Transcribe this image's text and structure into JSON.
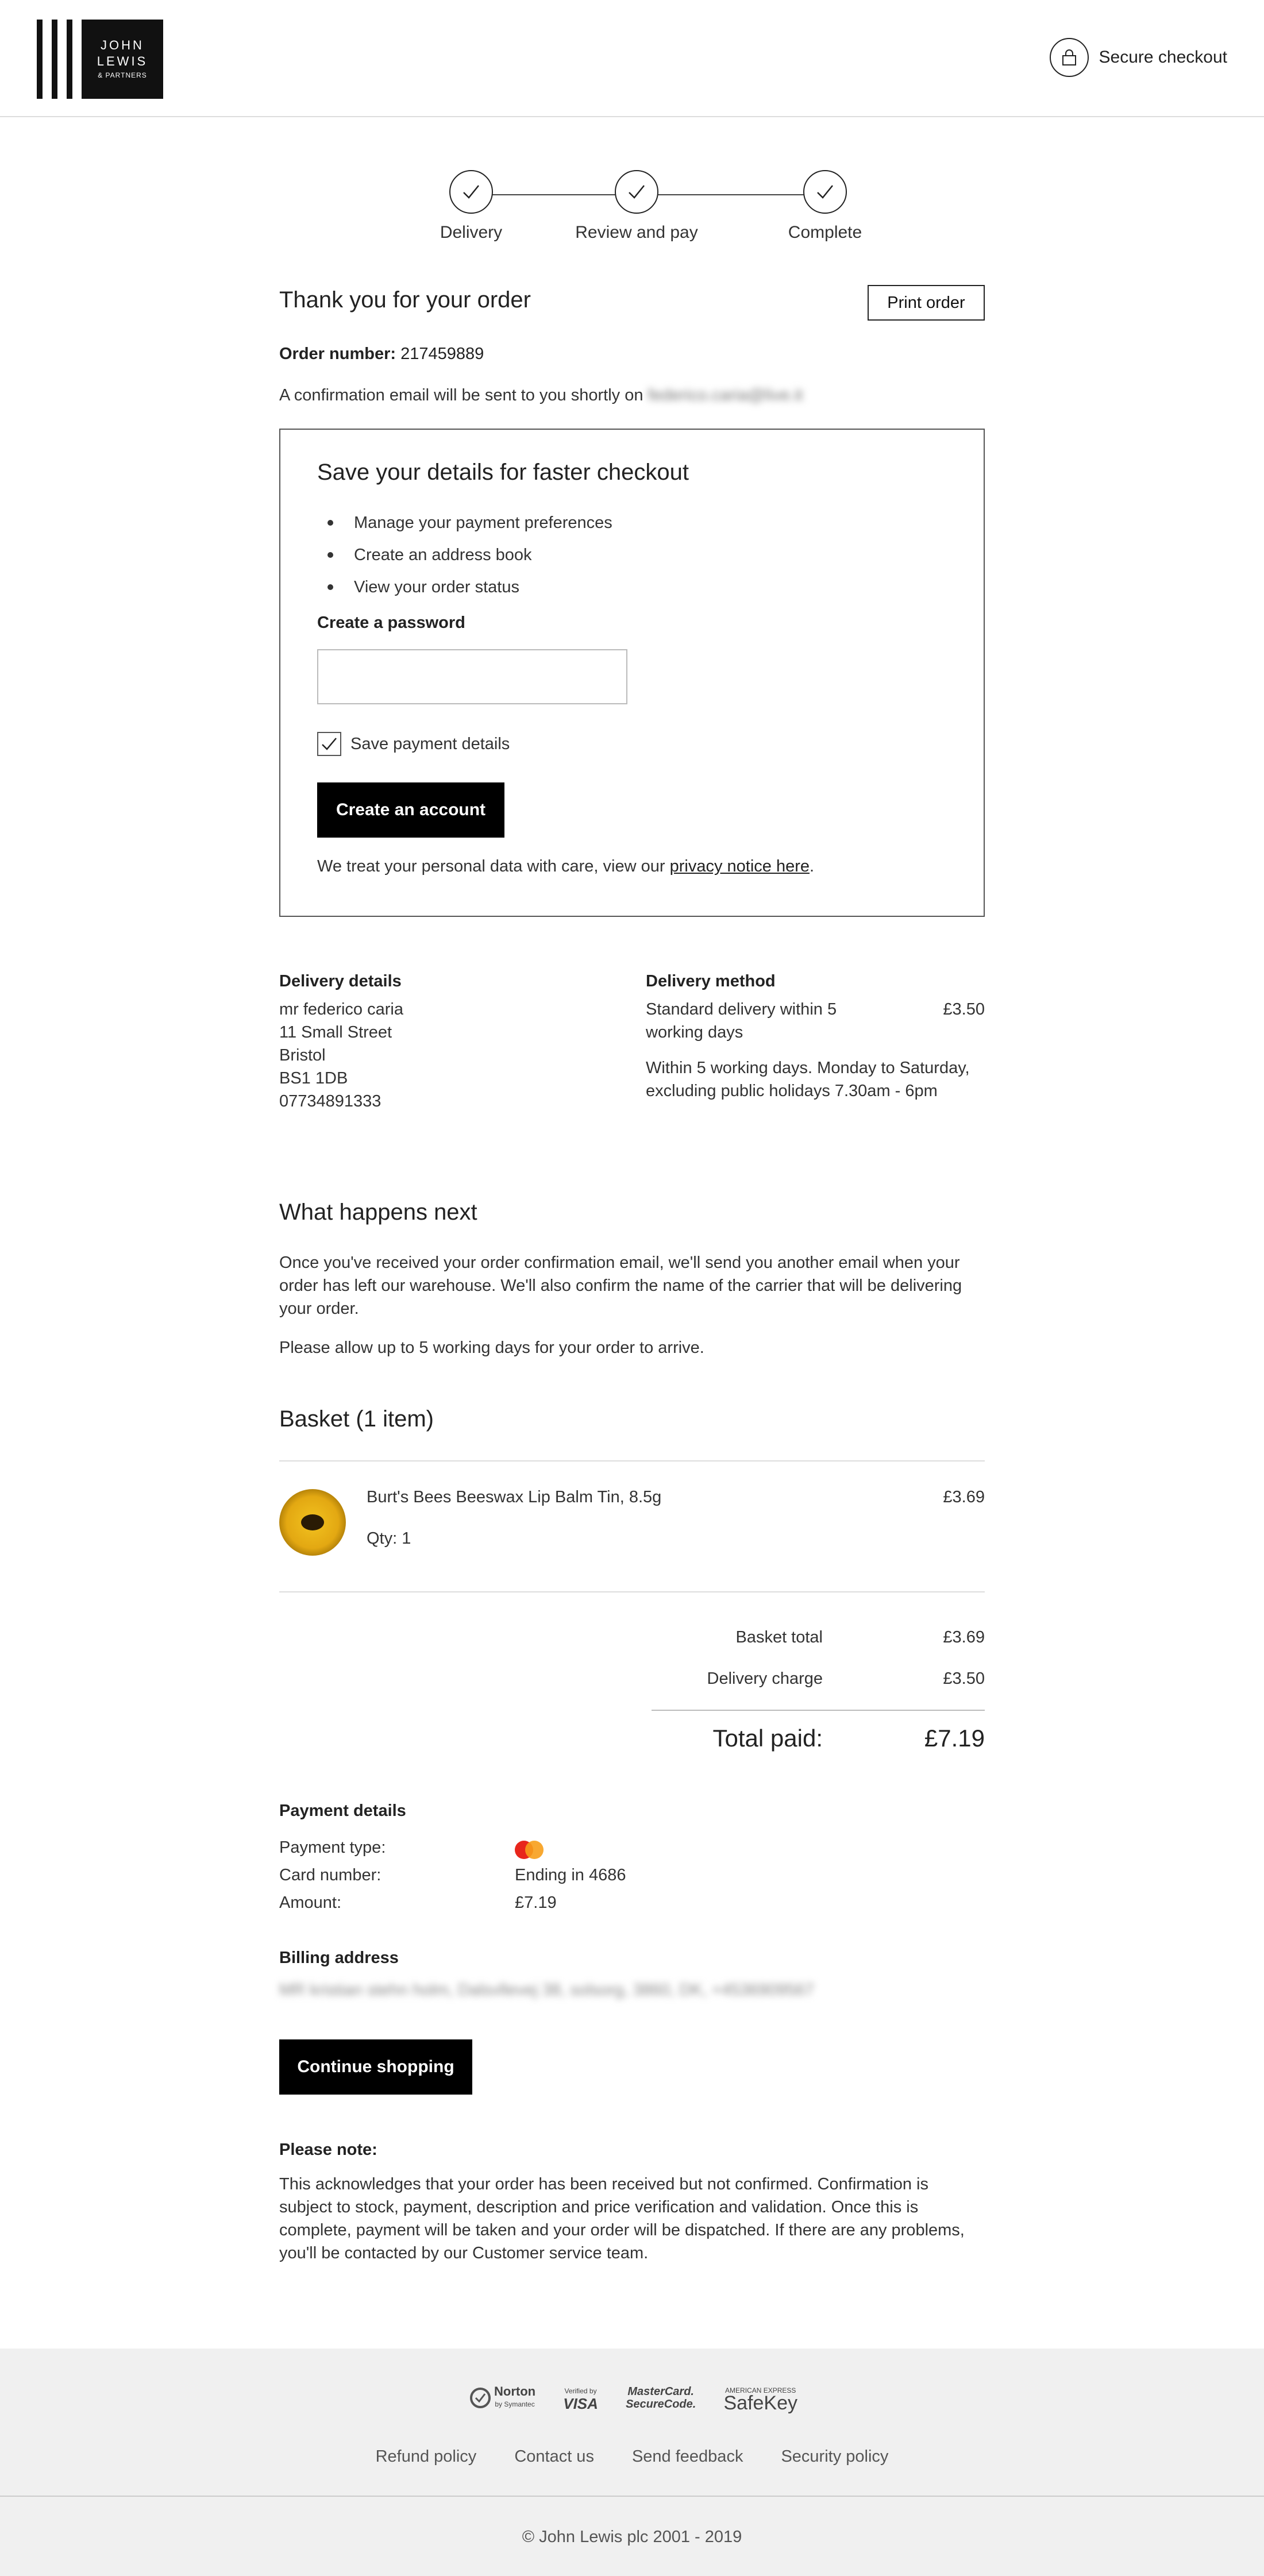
{
  "header": {
    "logo_line1": "JOHN",
    "logo_line2": "LEWIS",
    "logo_line3": "& PARTNERS",
    "secure_label": "Secure checkout"
  },
  "steps": [
    {
      "label": "Delivery",
      "state": "complete"
    },
    {
      "label": "Review and pay",
      "state": "complete"
    },
    {
      "label": "Complete",
      "state": "complete"
    }
  ],
  "order": {
    "title": "Thank you for your order",
    "print_label": "Print order",
    "number_label": "Order number:",
    "number": "217459889",
    "confirm_text": "A confirmation email will be sent to you shortly on",
    "email": "federico.caria@live.it"
  },
  "save_details": {
    "title": "Save your details for faster checkout",
    "benefits": [
      "Manage your payment preferences",
      "Create an address book",
      "View your order status"
    ],
    "password_label": "Create a password",
    "password_value": "",
    "save_payment_label": "Save payment details",
    "save_payment_checked": true,
    "create_button": "Create an account",
    "privacy_text": "We treat your personal data with care, view our",
    "privacy_link": "privacy notice here",
    "privacy_end": "."
  },
  "delivery_details": {
    "heading": "Delivery details",
    "lines": [
      "mr federico caria",
      "11 Small Street",
      "Bristol",
      "BS1 1DB",
      "07734891333"
    ]
  },
  "delivery_method": {
    "heading": "Delivery method",
    "name": "Standard delivery within 5 working days",
    "price": "£3.50",
    "note": "Within 5 working days. Monday to Saturday, excluding public holidays 7.30am - 6pm"
  },
  "next": {
    "title": "What happens next",
    "p1": "Once you've received your order confirmation email, we'll send you another email when your order has left our warehouse. We'll also confirm the name of the carrier that will be delivering your order.",
    "p2": "Please allow up to 5 working days for your order to arrive."
  },
  "basket": {
    "title": "Basket (1 item)",
    "items": [
      {
        "name": "Burt's Bees Beeswax Lip Balm Tin, 8.5g",
        "qty": "Qty: 1",
        "price": "£3.69"
      }
    ],
    "basket_total_label": "Basket total",
    "basket_total": "£3.69",
    "delivery_label": "Delivery charge",
    "delivery": "£3.50",
    "total_label": "Total paid:",
    "total": "£7.19"
  },
  "payment": {
    "heading": "Payment details",
    "type_label": "Payment type:",
    "type_icon": "mastercard-icon",
    "card_label": "Card number:",
    "card_value": "Ending in 4686",
    "amount_label": "Amount:",
    "amount_value": "£7.19"
  },
  "billing": {
    "heading": "Billing address",
    "value": "MR kristian stehn holm, Dalsvllevej 38, solsorg, 3860, DK, +4536909567"
  },
  "continue_label": "Continue shopping",
  "note": {
    "heading": "Please note:",
    "text": "This acknowledges that your order has been received but not confirmed. Confirmation is subject to stock, payment, description and price verification and validation. Once this is complete, payment will be taken and your order will be dispatched. If there are any problems, you'll be contacted by our Customer service team."
  },
  "footer": {
    "badges": {
      "norton": "Norton",
      "norton_sub": "by Symantec",
      "visa_top": "Verified by",
      "visa": "VISA",
      "mc_line1": "MasterCard.",
      "mc_line2": "SecureCode.",
      "amex_top": "AMERICAN EXPRESS",
      "amex": "SafeKey"
    },
    "links": [
      "Refund policy",
      "Contact us",
      "Send feedback",
      "Security policy"
    ],
    "copyright": "© John Lewis plc 2001 - 2019"
  }
}
